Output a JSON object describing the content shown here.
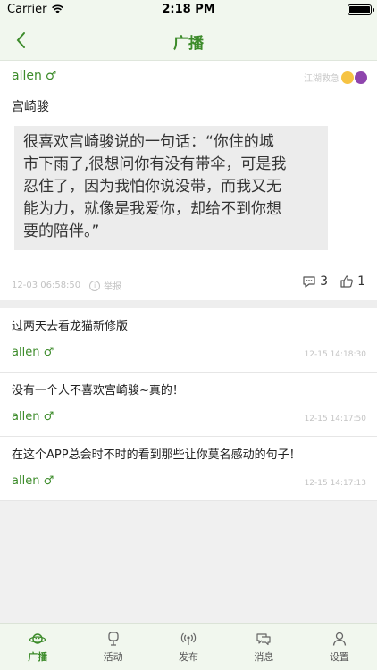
{
  "status_bar": {
    "carrier": "Carrier",
    "time": "2:18 PM"
  },
  "nav": {
    "title": "广播"
  },
  "featured_post": {
    "user": "allen",
    "gender_symbol": "♂",
    "badge_text": "江湖救急",
    "title": "宫崎骏",
    "quote_lines": [
      "很喜欢宫崎骏说的一句话：“你住的城",
      "市下雨了,很想问你有没有带伞，可是我",
      "忍住了，因为我怕你说没带，而我又无",
      "能为力，就像是我爱你，却给不到你想",
      "要的陪伴。”"
    ],
    "timestamp": "12-03 06:58:50",
    "report_label": "举报",
    "comment_count": "3",
    "like_count": "1"
  },
  "posts": [
    {
      "title": "过两天去看龙猫新修版",
      "user": "allen",
      "gender_symbol": "♂",
      "time": "12-15 14:18:30"
    },
    {
      "title": "没有一个人不喜欢宫崎骏~真的！",
      "user": "allen",
      "gender_symbol": "♂",
      "time": "12-15 14:17:50"
    },
    {
      "title": "在这个APP总会时不时的看到那些让你莫名感动的句子！",
      "user": "allen",
      "gender_symbol": "♂",
      "time": "12-15 14:17:13"
    }
  ],
  "tabs": [
    {
      "label": "广播",
      "icon": "planet-icon",
      "active": true
    },
    {
      "label": "活动",
      "icon": "activity-icon",
      "active": false
    },
    {
      "label": "发布",
      "icon": "broadcast-icon",
      "active": false
    },
    {
      "label": "消息",
      "icon": "chat-icon",
      "active": false
    },
    {
      "label": "设置",
      "icon": "person-icon",
      "active": false
    }
  ],
  "colors": {
    "accent": "#3c8b2a",
    "bar_bg": "#f1f7ee",
    "page_bg": "#f0f0f0"
  }
}
